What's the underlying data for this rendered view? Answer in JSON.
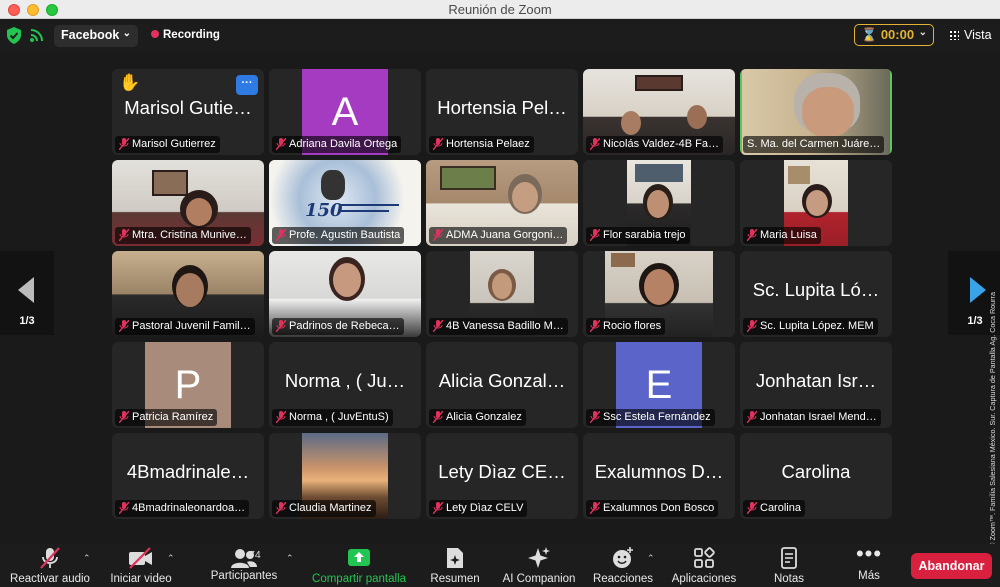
{
  "window": {
    "title": "Reunión de Zoom"
  },
  "topbar": {
    "stream_label": "Facebook",
    "recording_label": "Recording",
    "timer": "00:00",
    "view_label": "Vista"
  },
  "gallery": {
    "page_left": "1/3",
    "page_right": "1/3",
    "tiles": [
      {
        "label": "Marisol Gutierrez",
        "big_name": "Marisol Gutie…"
      },
      {
        "label": "Adriana Davila Ortega",
        "avatar": "A",
        "avatar_color": "#a43bc0"
      },
      {
        "label": "Hortensia Pelaez",
        "big_name": "Hortensia Pel…"
      },
      {
        "label": "Nicolás Valdez-4B Fa…"
      },
      {
        "label": "S. Ma. del Carmen Juáre…"
      },
      {
        "label": "Mtra. Cristina Munive…"
      },
      {
        "label": "Profe. Agustin Bautista",
        "image_text": "150"
      },
      {
        "label": "ADMA Juana Gorgoni…"
      },
      {
        "label": "Flor sarabia trejo"
      },
      {
        "label": "Maria Luisa"
      },
      {
        "label": "Pastoral Juvenil Famil…"
      },
      {
        "label": "Padrinos de Rebeca…"
      },
      {
        "label": "4B Vanessa Badillo M…"
      },
      {
        "label": "Rocio flores"
      },
      {
        "label": "Sc. Lupita López. MEM",
        "big_name": "Sc. Lupita Ló…"
      },
      {
        "label": "Patricia Ramírez",
        "avatar": "P",
        "avatar_color": "#a88b7a"
      },
      {
        "label": "Norma , ( JuvEntuS)",
        "big_name": "Norma , ( Ju…"
      },
      {
        "label": "Alicia Gonzalez",
        "big_name": "Alicia Gonzal…"
      },
      {
        "label": "Ssc Estela Fernández",
        "avatar": "E",
        "avatar_color": "#5a64c9"
      },
      {
        "label": "Jonhatan Israel Mend…",
        "big_name": "Jonhatan Isr…"
      },
      {
        "label": "4Bmadrinaleonardoa…",
        "big_name": "4Bmadrinale…"
      },
      {
        "label": "Claudia Martinez"
      },
      {
        "label": "Lety Dìaz CELV",
        "big_name": "Lety Dìaz CE…"
      },
      {
        "label": "Exalumnos Don Bosco",
        "big_name": "Exalumnos D…"
      },
      {
        "label": "Carolina",
        "big_name": "Carolina"
      }
    ]
  },
  "credit": "Cortesía © Zoom™. Familia Salesiana México. Sur. Captura de Pantalla Ag. Coca Rourra",
  "toolbar": {
    "audio_label": "Reactivar audio",
    "video_label": "Iniciar video",
    "participants_label": "Participantes",
    "participants_count": "74",
    "share_label": "Compartir pantalla",
    "summary_label": "Resumen",
    "companion_label": "AI Companion",
    "reactions_label": "Reacciones",
    "apps_label": "Aplicaciones",
    "notes_label": "Notas",
    "more_label": "Más",
    "leave_label": "Abandonar"
  },
  "colors": {
    "accent_green": "#23c552",
    "leave_red": "#d9203f",
    "timer_gold": "#e3b233",
    "active_border": "#5cc85c"
  }
}
